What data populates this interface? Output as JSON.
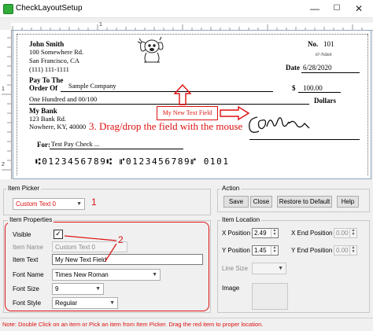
{
  "window": {
    "title": "CheckLayoutSetup",
    "minimize": "—",
    "maximize": "☐",
    "close": "✕"
  },
  "rulers": {
    "top_number": "1",
    "left_numbers": [
      "1",
      "2"
    ]
  },
  "check": {
    "payer_name": "John Smith",
    "payer_address1": "100 Somewhere Rd.",
    "payer_address2": "San Francisco, CA",
    "payer_phone": "(111) 111-1111",
    "number_label": "No.",
    "number_value": "101",
    "routing_fraction": "67-7658/0",
    "date_label": "Date",
    "date_value": "6/28/2020",
    "pay_to_label_1": "Pay To The",
    "pay_to_label_2": "Order Of",
    "payee": "Sample Company",
    "dollar_sign": "$",
    "amount": "100.00",
    "amount_words": "One Hundred  and 00/100",
    "dollars_label": "Dollars",
    "bank_name": "My Bank",
    "bank_address1": "123 Bank Rd.",
    "bank_address2": "Nowhere, KY, 40000",
    "memo_label": "For:",
    "memo_value": "Test Pay Check ...",
    "micr": "⑆0123456789⑆  ⑈0123456789⑈  0101",
    "new_field_label": "My New Text Field",
    "instruction": "3. Drag/drop the field with the mouse",
    "signature_text": "CGoryw"
  },
  "item_picker": {
    "group_label": "Item Picker",
    "selected": "Custom Text 0",
    "annotation": "1"
  },
  "item_properties": {
    "group_label": "Item Properties",
    "visible_label": "Visible",
    "visible_checked": true,
    "item_name_label": "Item Name",
    "item_name_value": "Custom Text 0",
    "item_text_label": "Item Text",
    "item_text_value": "My New Text Field",
    "font_name_label": "Font Name",
    "font_name_value": "Times New Roman",
    "font_size_label": "Font Size",
    "font_size_value": "9",
    "font_style_label": "Font Style",
    "font_style_value": "Regular",
    "annotation": "2"
  },
  "action": {
    "group_label": "Action",
    "save": "Save",
    "close": "Close",
    "restore": "Restore to Default",
    "help": "Help"
  },
  "item_location": {
    "group_label": "Item Location",
    "x_label": "X Position",
    "x_value": "2.49",
    "y_label": "Y Position",
    "y_value": "1.45",
    "x_end_label": "X End Position",
    "x_end_value": "0.00",
    "y_end_label": "Y End Position",
    "y_end_value": "0.00",
    "line_size_label": "Line Size",
    "image_label": "Image"
  },
  "status": {
    "text": "Note: Double Click on an item or Pick an item from Item Picker. Drag the red item to proper location."
  },
  "colors": {
    "annotation_red": "#dd1111",
    "check_border": "#8fa3c8"
  }
}
